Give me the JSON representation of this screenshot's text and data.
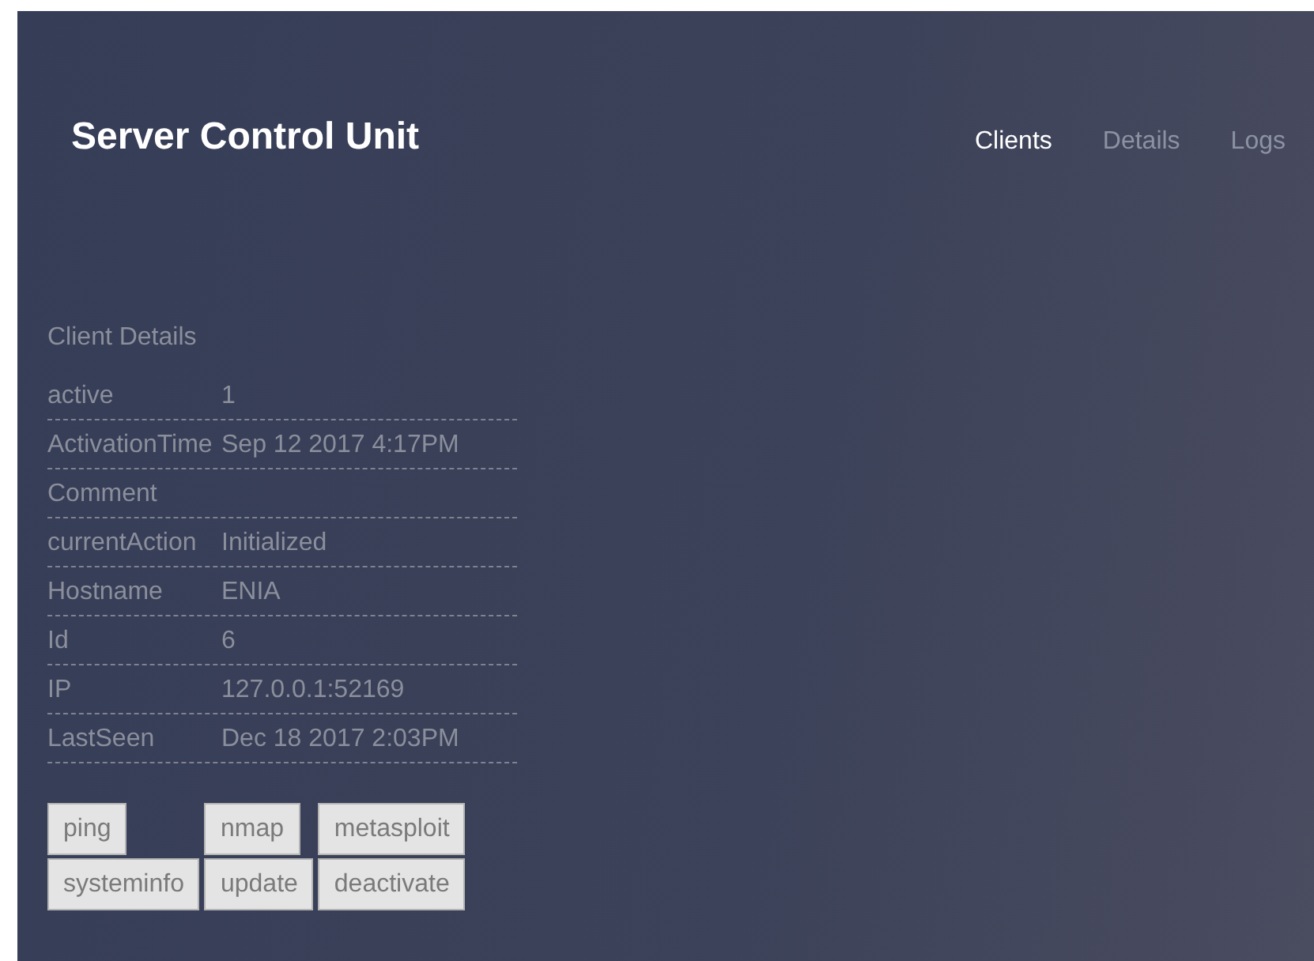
{
  "header": {
    "title": "Server Control Unit"
  },
  "nav": [
    {
      "label": "Clients",
      "selected": true
    },
    {
      "label": "Details",
      "selected": false
    },
    {
      "label": "Logs",
      "selected": false
    }
  ],
  "details": {
    "title": "Client Details",
    "rows": [
      {
        "label": "active",
        "value": "1"
      },
      {
        "label": "ActivationTime",
        "value": "Sep 12 2017 4:17PM"
      },
      {
        "label": "Comment",
        "value": ""
      },
      {
        "label": "currentAction",
        "value": "Initialized"
      },
      {
        "label": "Hostname",
        "value": "ENIA"
      },
      {
        "label": "Id",
        "value": "6"
      },
      {
        "label": "IP",
        "value": "127.0.0.1:52169"
      },
      {
        "label": "LastSeen",
        "value": "Dec 18 2017 2:03PM"
      }
    ]
  },
  "actions": [
    "ping",
    "nmap",
    "metasploit",
    "systeminfo",
    "update",
    "deactivate"
  ]
}
